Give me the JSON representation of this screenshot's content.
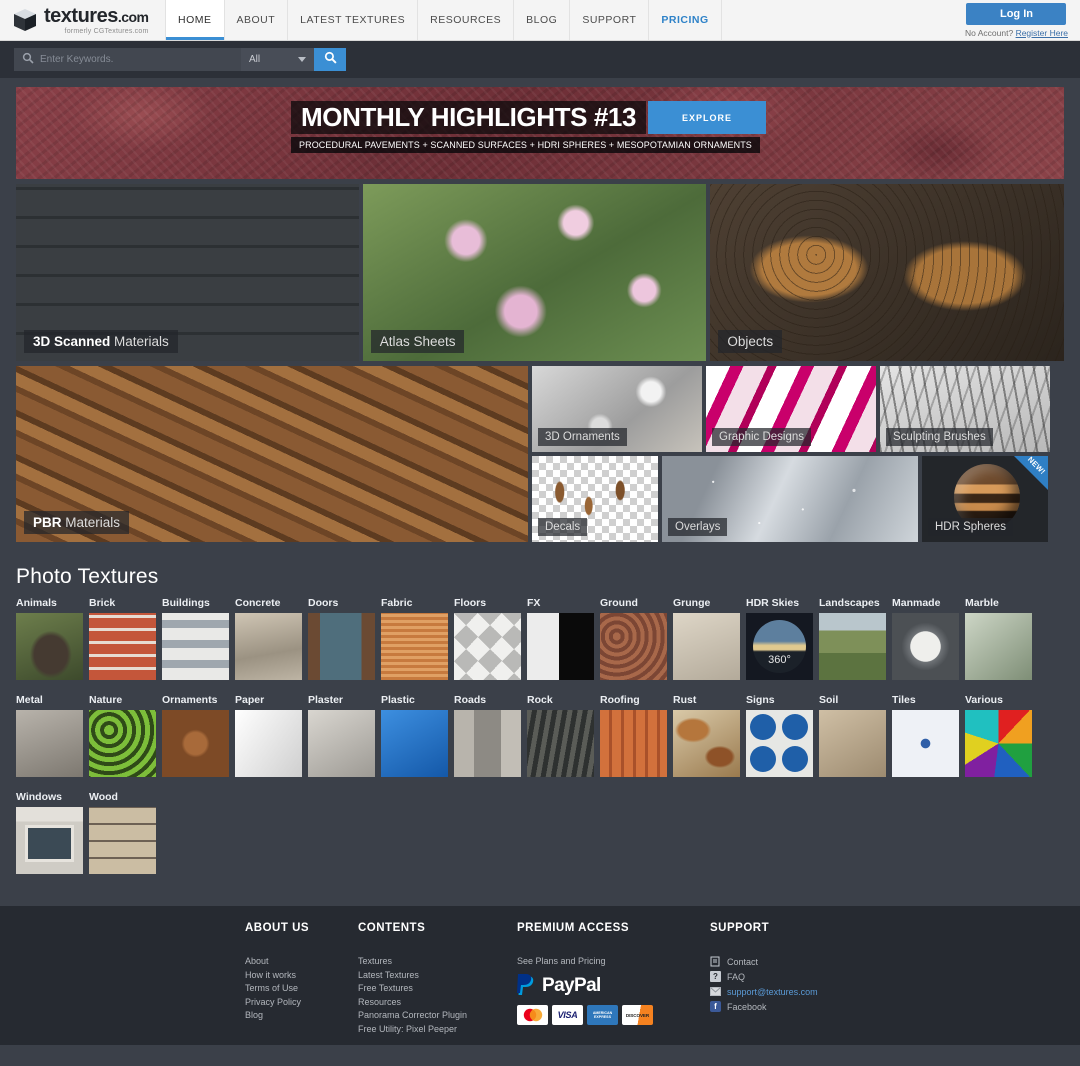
{
  "header": {
    "logo": {
      "name": "textures",
      "suffix": ".com",
      "tagline": "formerly CGTextures.com",
      "icon": "cube-icon"
    },
    "nav": [
      {
        "label": "HOME",
        "active": true,
        "accent": false
      },
      {
        "label": "ABOUT",
        "active": false,
        "accent": false
      },
      {
        "label": "LATEST TEXTURES",
        "active": false,
        "accent": false
      },
      {
        "label": "RESOURCES",
        "active": false,
        "accent": false
      },
      {
        "label": "BLOG",
        "active": false,
        "accent": false
      },
      {
        "label": "SUPPORT",
        "active": false,
        "accent": false
      },
      {
        "label": "PRICING",
        "active": false,
        "accent": true
      }
    ],
    "auth": {
      "login_label": "Log In",
      "no_account_text": "No Account?",
      "register_label": "Register Here"
    }
  },
  "search": {
    "placeholder": "Enter Keywords.",
    "value": "",
    "category_selected": "All",
    "search_icon": "search-icon",
    "dropdown_icon": "chevron-down-icon",
    "go_icon": "search-icon"
  },
  "banner": {
    "title": "MONTHLY HIGHLIGHTS #13",
    "cta_label": "EXPLORE",
    "subtitle": "PROCEDURAL PAVEMENTS + SCANNED SURFACES + HDRI SPHERES + MESOPOTAMIAN ORNAMENTS"
  },
  "features_row1": [
    {
      "bold": "3D Scanned",
      "rest": " Materials",
      "image": "dark-stone-wall"
    },
    {
      "bold": "",
      "rest": "Atlas Sheets",
      "image": "magnolia-flowers"
    },
    {
      "bold": "",
      "rest": "Objects",
      "image": "seeded-bread-rolls"
    }
  ],
  "features_big": {
    "bold": "PBR",
    "rest": " Materials",
    "image": "woven-rope-wood"
  },
  "features_small": [
    {
      "label": "3D Ornaments",
      "image": "silver-scroll-ornament",
      "badge": ""
    },
    {
      "label": "Graphic Designs",
      "image": "magenta-white-stripes",
      "badge": ""
    },
    {
      "label": "Sculpting Brushes",
      "image": "grey-brush-strokes",
      "badge": ""
    },
    {
      "label": "Decals",
      "image": "rust-decals-alpha",
      "badge": ""
    },
    {
      "label": "Overlays",
      "image": "water-droplets-overlay",
      "badge": ""
    },
    {
      "label": "HDR Spheres",
      "image": "chrome-hdr-sphere",
      "badge": "NEW!"
    }
  ],
  "photo_textures": {
    "heading": "Photo Textures",
    "categories": [
      {
        "label": "Animals",
        "image": "gorilla"
      },
      {
        "label": "Brick",
        "image": "red-brick-wall"
      },
      {
        "label": "Buildings",
        "image": "office-facade"
      },
      {
        "label": "Concrete",
        "image": "concrete-wall"
      },
      {
        "label": "Doors",
        "image": "blue-wooden-door"
      },
      {
        "label": "Fabric",
        "image": "orange-woven-fabric"
      },
      {
        "label": "Floors",
        "image": "diamond-tile-floor"
      },
      {
        "label": "FX",
        "image": "blood-drip-and-fire"
      },
      {
        "label": "Ground",
        "image": "red-gravel-ground"
      },
      {
        "label": "Grunge",
        "image": "cracked-grunge"
      },
      {
        "label": "HDR Skies",
        "image": "sky-dome-360"
      },
      {
        "label": "Landscapes",
        "image": "green-hills"
      },
      {
        "label": "Manmade",
        "image": "pressure-gauge"
      },
      {
        "label": "Marble",
        "image": "green-marble"
      },
      {
        "label": "Metal",
        "image": "scratched-metal"
      },
      {
        "label": "Nature",
        "image": "green-ivy-leaves"
      },
      {
        "label": "Ornaments",
        "image": "carved-wood-panel"
      },
      {
        "label": "Paper",
        "image": "crumpled-paper"
      },
      {
        "label": "Plaster",
        "image": "peeling-plaster"
      },
      {
        "label": "Plastic",
        "image": "blue-plastic"
      },
      {
        "label": "Roads",
        "image": "asphalt-road"
      },
      {
        "label": "Rock",
        "image": "dark-rock-face"
      },
      {
        "label": "Roofing",
        "image": "terracotta-roof-tiles"
      },
      {
        "label": "Rust",
        "image": "rusted-metal"
      },
      {
        "label": "Signs",
        "image": "blue-road-signs"
      },
      {
        "label": "Soil",
        "image": "cracked-dry-soil"
      },
      {
        "label": "Tiles",
        "image": "blue-patterned-tiles"
      },
      {
        "label": "Various",
        "image": "colorful-umbrella"
      },
      {
        "label": "Windows",
        "image": "building-window"
      },
      {
        "label": "Wood",
        "image": "wood-planks"
      }
    ],
    "hdr_badge": "360°"
  },
  "footer": {
    "about": {
      "heading": "ABOUT US",
      "links": [
        "About",
        "How it works",
        "Terms of Use",
        "Privacy Policy",
        "Blog"
      ]
    },
    "contents": {
      "heading": "CONTENTS",
      "links": [
        "Textures",
        "Latest Textures",
        "Free Textures",
        "Resources",
        "Panorama Corrector Plugin",
        "Free Utility: Pixel Peeper"
      ]
    },
    "premium": {
      "heading": "PREMIUM ACCESS",
      "plans_label": "See Plans and Pricing",
      "paypal_label": "PayPal",
      "cards": [
        "MasterCard",
        "VISA",
        "AMERICAN EXPRESS",
        "DISCOVER"
      ]
    },
    "support": {
      "heading": "SUPPORT",
      "items": [
        {
          "label": "Contact",
          "icon": "contact-form-icon"
        },
        {
          "label": "FAQ",
          "icon": "question-icon"
        },
        {
          "label": "support@textures.com",
          "icon": "mail-icon"
        },
        {
          "label": "Facebook",
          "icon": "facebook-icon"
        }
      ]
    }
  },
  "colors": {
    "accent": "#3b8fd4",
    "page_bg": "#3b4049",
    "footer_bg": "#262a31",
    "header_bg": "#f4f4f4"
  }
}
